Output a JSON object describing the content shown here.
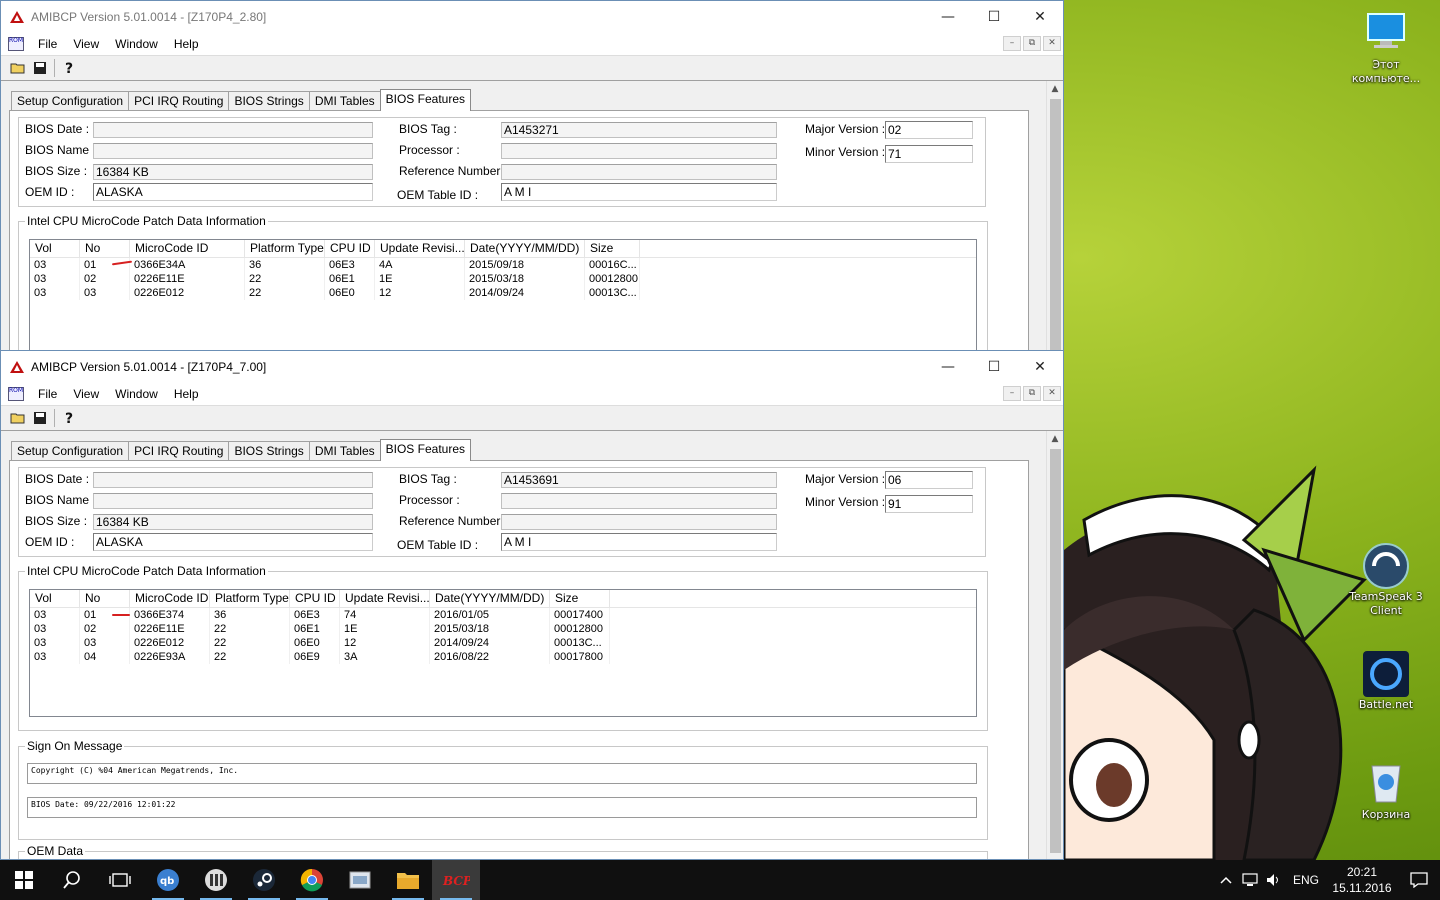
{
  "desktop": {
    "icons": [
      {
        "name": "this-pc",
        "label": "Этот компьюте..."
      },
      {
        "name": "teamspeak",
        "label": "TeamSpeak 3 Client"
      },
      {
        "name": "battlenet",
        "label": "Battle.net"
      },
      {
        "name": "recycle-bin",
        "label": "Корзина"
      }
    ]
  },
  "window1": {
    "title": "AMIBCP Version 5.01.0014 - [Z170P4_2.80]",
    "menu": [
      "File",
      "View",
      "Window",
      "Help"
    ],
    "tabs": [
      "Setup Configuration",
      "PCI IRQ Routing",
      "BIOS Strings",
      "DMI Tables",
      "BIOS Features"
    ],
    "active_tab": "BIOS Features",
    "info": {
      "bios_date_label": "BIOS Date :",
      "bios_date": "",
      "bios_name_label": "BIOS Name :",
      "bios_name": "",
      "bios_size_label": "BIOS Size :",
      "bios_size": "16384 KB",
      "oem_id_label": "OEM ID :",
      "oem_id": "ALASKA",
      "bios_tag_label": "BIOS Tag :",
      "bios_tag": "A1453271",
      "processor_label": "Processor :",
      "processor": "",
      "reference_label": "Reference Number :",
      "reference": "",
      "oem_table_label": "OEM Table ID :",
      "oem_table": "A M I",
      "major_label": "Major Version :",
      "major": "02",
      "minor_label": "Minor Version :",
      "minor": "71"
    },
    "microcode": {
      "group_title": "Intel CPU MicroCode Patch Data Information",
      "columns": [
        "Vol",
        "No",
        "MicroCode ID",
        "Platform Type",
        "CPU ID",
        "Update Revisi...",
        "Date(YYYY/MM/DD)",
        "Size"
      ],
      "rows": [
        [
          "03",
          "01",
          "0366E34A",
          "36",
          "06E3",
          "4A",
          "2015/09/18",
          "00016C..."
        ],
        [
          "03",
          "02",
          "0226E11E",
          "22",
          "06E1",
          "1E",
          "2015/03/18",
          "00012800"
        ],
        [
          "03",
          "03",
          "0226E012",
          "22",
          "06E0",
          "12",
          "2014/09/24",
          "00013C..."
        ]
      ]
    }
  },
  "window2": {
    "title": "AMIBCP Version 5.01.0014 - [Z170P4_7.00]",
    "menu": [
      "File",
      "View",
      "Window",
      "Help"
    ],
    "tabs": [
      "Setup Configuration",
      "PCI IRQ Routing",
      "BIOS Strings",
      "DMI Tables",
      "BIOS Features"
    ],
    "active_tab": "BIOS Features",
    "info": {
      "bios_date_label": "BIOS Date :",
      "bios_date": "",
      "bios_name_label": "BIOS Name :",
      "bios_name": "",
      "bios_size_label": "BIOS Size :",
      "bios_size": "16384 KB",
      "oem_id_label": "OEM ID :",
      "oem_id": "ALASKA",
      "bios_tag_label": "BIOS Tag :",
      "bios_tag": "A1453691",
      "processor_label": "Processor :",
      "processor": "",
      "reference_label": "Reference Number :",
      "reference": "",
      "oem_table_label": "OEM Table ID :",
      "oem_table": "A M I",
      "major_label": "Major Version :",
      "major": "06",
      "minor_label": "Minor Version :",
      "minor": "91"
    },
    "microcode": {
      "group_title": "Intel CPU MicroCode Patch Data Information",
      "columns": [
        "Vol",
        "No",
        "MicroCode ID",
        "Platform Type",
        "CPU ID",
        "Update Revisi...",
        "Date(YYYY/MM/DD)",
        "Size"
      ],
      "rows": [
        [
          "03",
          "01",
          "0366E374",
          "36",
          "06E3",
          "74",
          "2016/01/05",
          "00017400"
        ],
        [
          "03",
          "02",
          "0226E11E",
          "22",
          "06E1",
          "1E",
          "2015/03/18",
          "00012800"
        ],
        [
          "03",
          "03",
          "0226E012",
          "22",
          "06E0",
          "12",
          "2014/09/24",
          "00013C..."
        ],
        [
          "03",
          "04",
          "0226E93A",
          "22",
          "06E9",
          "3A",
          "2016/08/22",
          "00017800"
        ]
      ]
    },
    "sign_on": {
      "group_title": "Sign On Message",
      "line1": "Copyright (C) %04 American Megatrends, Inc.",
      "line2": "BIOS Date: 09/22/2016 12:01:22"
    },
    "oem_data": {
      "group_title": "OEM Data"
    }
  },
  "taskbar": {
    "apps": [
      "start",
      "search",
      "task-view",
      "qbittorrent",
      "mixer",
      "steam",
      "chrome",
      "amibcp-mdi",
      "file-explorer",
      "amibcp"
    ],
    "lang": "ENG",
    "time": "20:21",
    "date": "15.11.2016"
  }
}
